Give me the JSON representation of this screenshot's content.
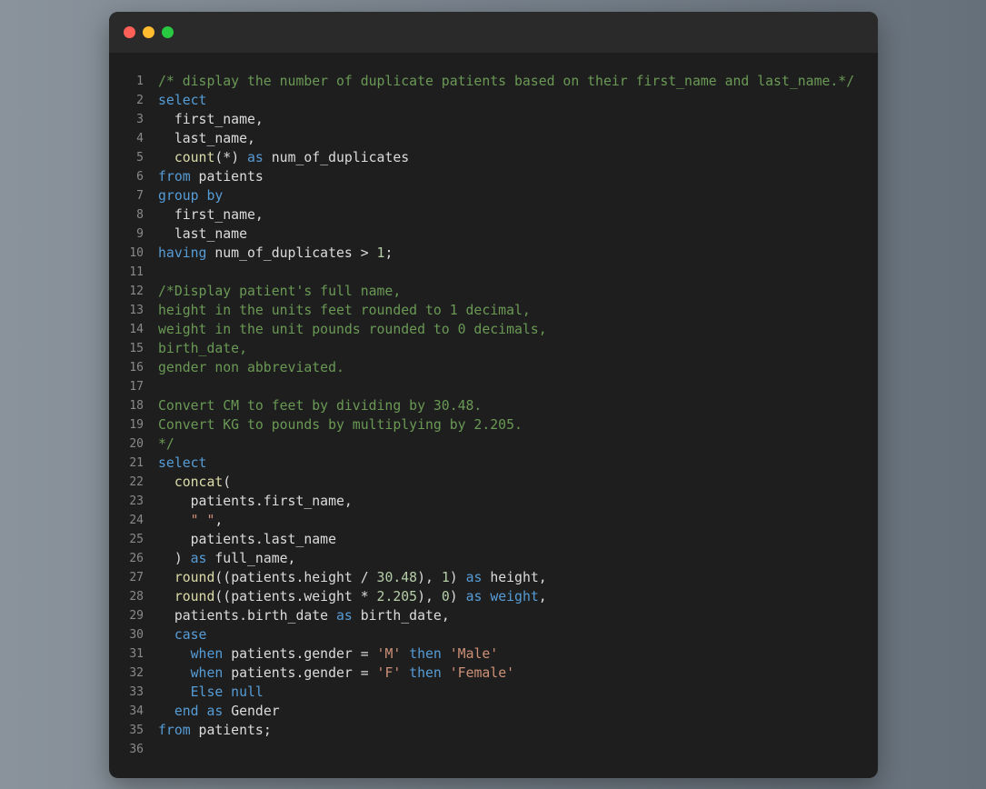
{
  "window": {
    "buttons": {
      "close": "close",
      "minimize": "minimize",
      "maximize": "maximize"
    }
  },
  "code": {
    "lines": [
      [
        [
          "cm",
          "/* display the number of duplicate patients based on their first_name and last_name.*/"
        ]
      ],
      [
        [
          "kw",
          "select"
        ]
      ],
      [
        [
          "pl",
          "  first_name,"
        ]
      ],
      [
        [
          "pl",
          "  last_name,"
        ]
      ],
      [
        [
          "pl",
          "  "
        ],
        [
          "fn",
          "count"
        ],
        [
          "pl",
          "(*) "
        ],
        [
          "kw",
          "as"
        ],
        [
          "pl",
          " num_of_duplicates"
        ]
      ],
      [
        [
          "kw",
          "from"
        ],
        [
          "pl",
          " patients"
        ]
      ],
      [
        [
          "kw",
          "group by"
        ]
      ],
      [
        [
          "pl",
          "  first_name,"
        ]
      ],
      [
        [
          "pl",
          "  last_name"
        ]
      ],
      [
        [
          "kw",
          "having"
        ],
        [
          "pl",
          " num_of_duplicates > "
        ],
        [
          "nm",
          "1"
        ],
        [
          "pl",
          ";"
        ]
      ],
      [],
      [
        [
          "cm",
          "/*Display patient's full name,"
        ]
      ],
      [
        [
          "cm",
          "height in the units feet rounded to 1 decimal,"
        ]
      ],
      [
        [
          "cm",
          "weight in the unit pounds rounded to 0 decimals,"
        ]
      ],
      [
        [
          "cm",
          "birth_date,"
        ]
      ],
      [
        [
          "cm",
          "gender non abbreviated."
        ]
      ],
      [],
      [
        [
          "cm",
          "Convert CM to feet by dividing by 30.48."
        ]
      ],
      [
        [
          "cm",
          "Convert KG to pounds by multiplying by 2.205."
        ]
      ],
      [
        [
          "cm",
          "*/"
        ]
      ],
      [
        [
          "kw",
          "select"
        ]
      ],
      [
        [
          "pl",
          "  "
        ],
        [
          "fn",
          "concat"
        ],
        [
          "pl",
          "("
        ]
      ],
      [
        [
          "pl",
          "    patients.first_name,"
        ]
      ],
      [
        [
          "pl",
          "    "
        ],
        [
          "st",
          "\" \""
        ],
        [
          "pl",
          ","
        ]
      ],
      [
        [
          "pl",
          "    patients.last_name"
        ]
      ],
      [
        [
          "pl",
          "  ) "
        ],
        [
          "kw",
          "as"
        ],
        [
          "pl",
          " full_name,"
        ]
      ],
      [
        [
          "pl",
          "  "
        ],
        [
          "fn",
          "round"
        ],
        [
          "pl",
          "((patients.height / "
        ],
        [
          "nm",
          "30.48"
        ],
        [
          "pl",
          "), "
        ],
        [
          "nm",
          "1"
        ],
        [
          "pl",
          ") "
        ],
        [
          "kw",
          "as"
        ],
        [
          "pl",
          " height,"
        ]
      ],
      [
        [
          "pl",
          "  "
        ],
        [
          "fn",
          "round"
        ],
        [
          "pl",
          "((patients.weight * "
        ],
        [
          "nm",
          "2.205"
        ],
        [
          "pl",
          "), "
        ],
        [
          "nm",
          "0"
        ],
        [
          "pl",
          ") "
        ],
        [
          "kw",
          "as"
        ],
        [
          "pl",
          " "
        ],
        [
          "kw",
          "weight"
        ],
        [
          "pl",
          ","
        ]
      ],
      [
        [
          "pl",
          "  patients.birth_date "
        ],
        [
          "kw",
          "as"
        ],
        [
          "pl",
          " birth_date,"
        ]
      ],
      [
        [
          "pl",
          "  "
        ],
        [
          "kw",
          "case"
        ]
      ],
      [
        [
          "pl",
          "    "
        ],
        [
          "kw",
          "when"
        ],
        [
          "pl",
          " patients.gender = "
        ],
        [
          "st",
          "'M'"
        ],
        [
          "pl",
          " "
        ],
        [
          "kw",
          "then"
        ],
        [
          "pl",
          " "
        ],
        [
          "st",
          "'Male'"
        ]
      ],
      [
        [
          "pl",
          "    "
        ],
        [
          "kw",
          "when"
        ],
        [
          "pl",
          " patients.gender = "
        ],
        [
          "st",
          "'F'"
        ],
        [
          "pl",
          " "
        ],
        [
          "kw",
          "then"
        ],
        [
          "pl",
          " "
        ],
        [
          "st",
          "'Female'"
        ]
      ],
      [
        [
          "pl",
          "    "
        ],
        [
          "kw",
          "Else null"
        ]
      ],
      [
        [
          "pl",
          "  "
        ],
        [
          "kw",
          "end as"
        ],
        [
          "pl",
          " Gender"
        ]
      ],
      [
        [
          "kw",
          "from"
        ],
        [
          "pl",
          " patients;"
        ]
      ],
      []
    ]
  }
}
